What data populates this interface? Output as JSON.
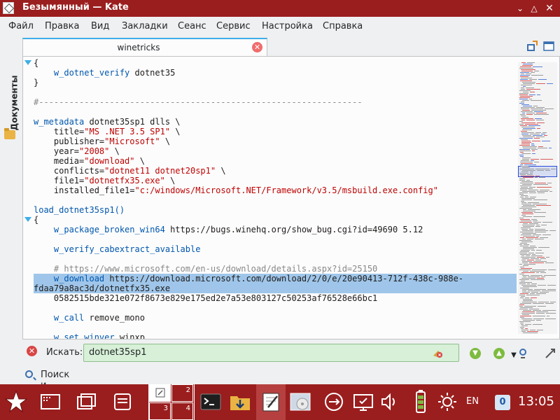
{
  "window": {
    "title": "Безымянный  — Kate"
  },
  "menu": [
    "Файл",
    "Правка",
    "Вид",
    "Закладки",
    "Сеанс",
    "Сервис",
    "Настройка",
    "Справка"
  ],
  "sidebar": {
    "label": "Документы"
  },
  "tab": {
    "label": "winetricks"
  },
  "code_lines": [
    [
      {
        "t": "{"
      }
    ],
    [
      {
        "t": "    "
      },
      {
        "t": "w_dotnet_verify",
        "c": "kw"
      },
      {
        "t": " dotnet35"
      }
    ],
    [
      {
        "t": "}"
      }
    ],
    [],
    [
      {
        "t": "#----------------------------------------------------------------",
        "c": "cmt"
      }
    ],
    [],
    [
      {
        "t": "w_metadata",
        "c": "kw"
      },
      {
        "t": " dotnet35sp1 dlls \\"
      }
    ],
    [
      {
        "t": "    title="
      },
      {
        "t": "\"MS .NET 3.5 SP1\"",
        "c": "str"
      },
      {
        "t": " \\"
      }
    ],
    [
      {
        "t": "    publisher="
      },
      {
        "t": "\"Microsoft\"",
        "c": "str"
      },
      {
        "t": " \\"
      }
    ],
    [
      {
        "t": "    year="
      },
      {
        "t": "\"2008\"",
        "c": "str"
      },
      {
        "t": " \\"
      }
    ],
    [
      {
        "t": "    media="
      },
      {
        "t": "\"download\"",
        "c": "str"
      },
      {
        "t": " \\"
      }
    ],
    [
      {
        "t": "    conflicts="
      },
      {
        "t": "\"dotnet11 dotnet20sp1\"",
        "c": "str"
      },
      {
        "t": " \\"
      }
    ],
    [
      {
        "t": "    file1="
      },
      {
        "t": "\"dotnetfx35.exe\"",
        "c": "str"
      },
      {
        "t": " \\"
      }
    ],
    [
      {
        "t": "    installed_file1="
      },
      {
        "t": "\"c:/windows/Microsoft.NET/Framework/v3.5/msbuild.exe.config\"",
        "c": "str"
      }
    ],
    [],
    [
      {
        "t": "load_dotnet35sp1()",
        "c": "kw"
      }
    ],
    [
      {
        "t": "{"
      }
    ],
    [
      {
        "t": "    "
      },
      {
        "t": "w_package_broken_win64",
        "c": "kw"
      },
      {
        "t": " https://bugs.winehq.org/show_bug.cgi?id=49690 5.12"
      }
    ],
    [],
    [
      {
        "t": "    "
      },
      {
        "t": "w_verify_cabextract_available",
        "c": "kw"
      }
    ],
    [],
    [
      {
        "t": "    # https://www.microsoft.com/en-us/download/details.aspx?id=25150",
        "c": "cmt"
      }
    ],
    [
      {
        "t": "    ",
        "c": "sel"
      },
      {
        "t": "w_download",
        "c": "kw sel"
      },
      {
        "t": " https://download.microsoft.com/download/2/0/e/20e90413-712f-438c-988e-",
        "c": "sel"
      }
    ],
    [
      {
        "t": "fdaa79a8ac3d/dotnetfx35.exe",
        "c": "sel"
      }
    ],
    [
      {
        "t": "    0582515bde321e072f8673e829e175ed2e7a53e803127c50253af76528e66bc1"
      }
    ],
    [],
    [
      {
        "t": "    "
      },
      {
        "t": "w_call",
        "c": "kw"
      },
      {
        "t": " remove_mono"
      }
    ],
    [],
    [
      {
        "t": "    "
      },
      {
        "t": "w_set_winver",
        "c": "kw"
      },
      {
        "t": " winxp"
      }
    ]
  ],
  "search": {
    "label": "Искать:",
    "value": "dotnet35sp1"
  },
  "search_replace": {
    "label": "Поиск и замена"
  },
  "taskbar": {
    "pager": [
      "",
      "2",
      "3",
      "4"
    ],
    "lang": "EN",
    "notifications": "0",
    "clock": "13:05"
  },
  "colors": {
    "accent": "#9a1e1e",
    "selection": "#9fc6ea",
    "keyword": "#0057ae",
    "string": "#bf0303"
  }
}
